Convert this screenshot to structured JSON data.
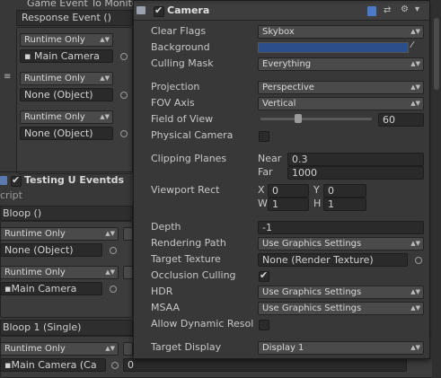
{
  "background": {
    "top_label": "Game Event To Monito",
    "response_event_header": "Response Event ()",
    "entries": [
      {
        "mode": "Runtime Only",
        "object": "Main Camera"
      },
      {
        "mode": "Runtime Only",
        "object": "None (Object)"
      },
      {
        "mode": "Runtime Only",
        "object": "None (Object)"
      }
    ],
    "testing_component": {
      "title": "Testing U Eventds",
      "script_label": "cript",
      "bloop_header": "Bloop ()",
      "entries": [
        {
          "mode": "Runtime Only",
          "object": "None (Object)"
        },
        {
          "mode": "Runtime Only",
          "object": "Main Camera"
        }
      ],
      "bloop1_header": "Bloop 1 (Single)",
      "bloop1_entry": {
        "mode": "Runtime Only",
        "object": "Main Camera (Ca",
        "value": "0"
      }
    }
  },
  "camera": {
    "title": "Camera",
    "colors": {
      "background": "#2a4f8a",
      "panel": "#383838"
    },
    "fields": {
      "clear_flags": {
        "label": "Clear Flags",
        "value": "Skybox"
      },
      "background": {
        "label": "Background"
      },
      "culling_mask": {
        "label": "Culling Mask",
        "value": "Everything"
      },
      "projection": {
        "label": "Projection",
        "value": "Perspective"
      },
      "fov_axis": {
        "label": "FOV Axis",
        "value": "Vertical"
      },
      "field_of_view": {
        "label": "Field of View",
        "value": "60",
        "slider_fraction": 0.33
      },
      "physical_camera": {
        "label": "Physical Camera",
        "checked": false
      },
      "clipping_planes": {
        "label": "Clipping Planes",
        "near_label": "Near",
        "near": "0.3",
        "far_label": "Far",
        "far": "1000"
      },
      "viewport_rect": {
        "label": "Viewport Rect",
        "x_label": "X",
        "x": "0",
        "y_label": "Y",
        "y": "0",
        "w_label": "W",
        "w": "1",
        "h_label": "H",
        "h": "1"
      },
      "depth": {
        "label": "Depth",
        "value": "-1"
      },
      "rendering_path": {
        "label": "Rendering Path",
        "value": "Use Graphics Settings"
      },
      "target_texture": {
        "label": "Target Texture",
        "value": "None (Render Texture)"
      },
      "occlusion_culling": {
        "label": "Occlusion Culling",
        "checked": true
      },
      "hdr": {
        "label": "HDR",
        "value": "Use Graphics Settings"
      },
      "msaa": {
        "label": "MSAA",
        "value": "Use Graphics Settings"
      },
      "allow_dynamic_resolution": {
        "label": "Allow Dynamic Resol",
        "checked": false
      },
      "target_display": {
        "label": "Target Display",
        "value": "Display 1"
      }
    }
  }
}
